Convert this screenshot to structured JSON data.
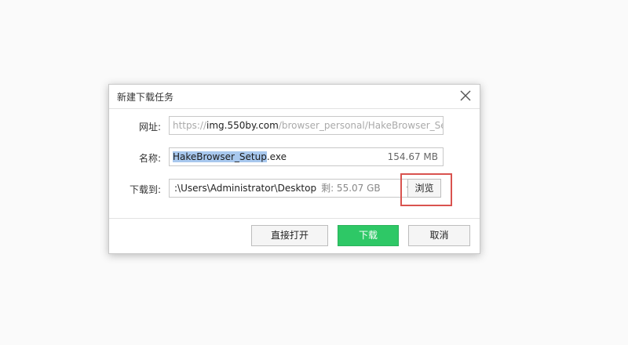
{
  "dialog": {
    "title": "新建下载任务",
    "close_icon": "close-icon"
  },
  "url_row": {
    "label": "网址:",
    "prefix": "https://",
    "host": "img.550by.com",
    "path": "/browser_personal/HakeBrowser_Se"
  },
  "name_row": {
    "label": "名称:",
    "selected_name": "HakeBrowser_Setup",
    "extension": ".exe",
    "file_size": "154.67 MB"
  },
  "path_row": {
    "label": "下载到:",
    "path": ":\\Users\\Administrator\\Desktop",
    "free_space": "剩: 55.07 GB",
    "browse_label": "浏览"
  },
  "buttons": {
    "open_label": "直接打开",
    "download_label": "下载",
    "cancel_label": "取消"
  },
  "colors": {
    "primary": "#2ec866",
    "highlight": "#d9534f",
    "selection": "#a8c8ee"
  }
}
